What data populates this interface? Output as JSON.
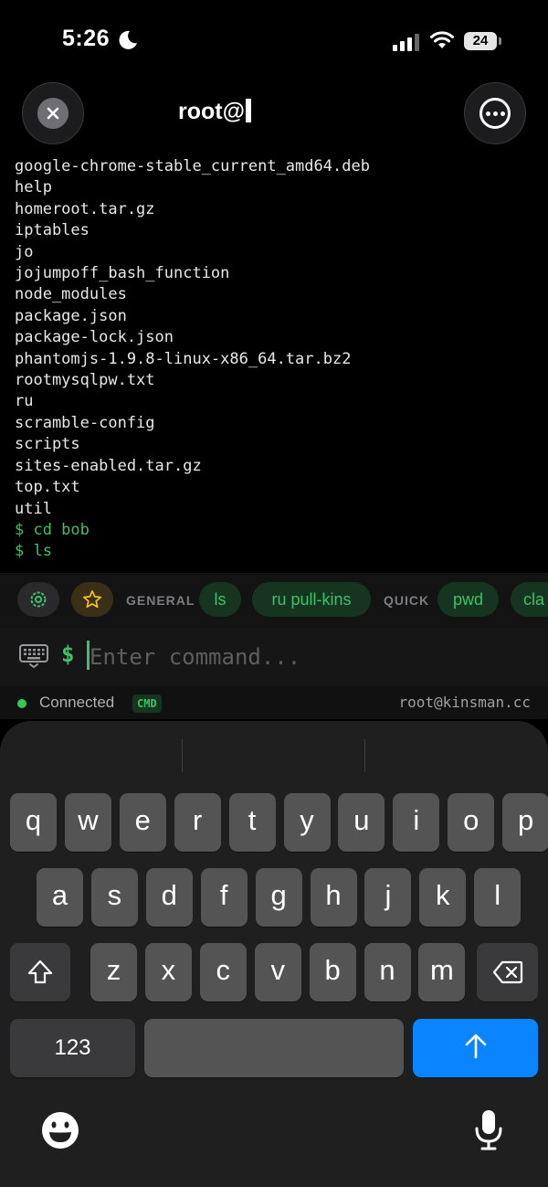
{
  "status": {
    "time": "5:26",
    "battery": "24"
  },
  "header": {
    "title": "root@"
  },
  "terminal": {
    "lines": [
      {
        "text": "google-chrome-stable_current_amd64.deb",
        "type": "output"
      },
      {
        "text": "help",
        "type": "output"
      },
      {
        "text": "homeroot.tar.gz",
        "type": "output"
      },
      {
        "text": "iptables",
        "type": "output"
      },
      {
        "text": "jo",
        "type": "output"
      },
      {
        "text": "jojumpoff_bash_function",
        "type": "output"
      },
      {
        "text": "node_modules",
        "type": "output"
      },
      {
        "text": "package.json",
        "type": "output"
      },
      {
        "text": "package-lock.json",
        "type": "output"
      },
      {
        "text": "phantomjs-1.9.8-linux-x86_64.tar.bz2",
        "type": "output"
      },
      {
        "text": "rootmysqlpw.txt",
        "type": "output"
      },
      {
        "text": "ru",
        "type": "output"
      },
      {
        "text": "scramble-config",
        "type": "output"
      },
      {
        "text": "scripts",
        "type": "output"
      },
      {
        "text": "sites-enabled.tar.gz",
        "type": "output"
      },
      {
        "text": "top.txt",
        "type": "output"
      },
      {
        "text": "util",
        "type": "output"
      },
      {
        "text": "$ cd bob",
        "type": "cmd"
      },
      {
        "text": "$ ls",
        "type": "cmd"
      }
    ]
  },
  "quickbar": {
    "general_label": "GENERAL",
    "general_items": [
      "ls",
      "ru pull-kins"
    ],
    "quick_label": "QUICK",
    "quick_items": [
      "pwd",
      "cla"
    ]
  },
  "input": {
    "prompt": "$",
    "placeholder": "Enter command...",
    "value": ""
  },
  "connection": {
    "status": "Connected",
    "badge": "CMD",
    "host": "root@kinsman.cc"
  },
  "keyboard": {
    "row1": [
      "q",
      "w",
      "e",
      "r",
      "t",
      "y",
      "u",
      "i",
      "o",
      "p"
    ],
    "row2": [
      "a",
      "s",
      "d",
      "f",
      "g",
      "h",
      "j",
      "k",
      "l"
    ],
    "row3": [
      "z",
      "x",
      "c",
      "v",
      "b",
      "n",
      "m"
    ],
    "numbers_label": "123",
    "accent_color": "#0a84ff"
  },
  "colors": {
    "terminal_green": "#3ec167",
    "status_green": "#34c759",
    "star_yellow": "#f5c518"
  }
}
